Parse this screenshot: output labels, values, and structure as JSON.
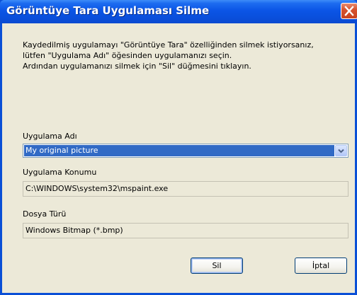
{
  "window": {
    "title": "Görüntüye Tara Uygulaması Silme"
  },
  "description": {
    "lines": [
      "Kaydedilmiş uygulamayı \"Görüntüye Tara\" özelliğinden silmek istiyorsanız,",
      "lütfen \"Uygulama Adı\" öğesinden uygulamanızı seçin.",
      "Ardından uygulamanızı silmek için \"Sil\" düğmesini tıklayın."
    ]
  },
  "app_name": {
    "label": "Uygulama Adı",
    "selected": "My original picture"
  },
  "app_location": {
    "label": "Uygulama Konumu",
    "value": "C:\\WINDOWS\\system32\\mspaint.exe"
  },
  "file_type": {
    "label": "Dosya Türü",
    "value": "Windows Bitmap (*.bmp)"
  },
  "buttons": {
    "delete_label": "Sil",
    "cancel_label": "İptal"
  },
  "icons": {
    "close": "close-icon",
    "dropdown": "chevron-down-icon"
  },
  "colors": {
    "title_bar": "#0a4fdc",
    "client_background": "#ece9d8",
    "selection": "#316ac5",
    "close_button": "#d6532f"
  }
}
